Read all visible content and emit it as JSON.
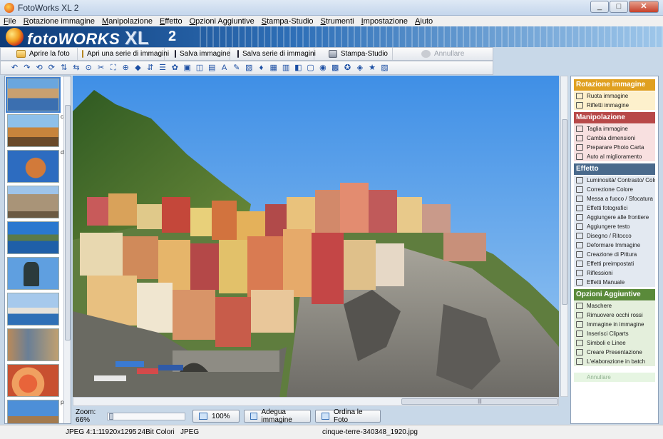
{
  "window": {
    "title": "FotoWorks XL 2",
    "minimize": "_",
    "maximize": "□",
    "close": "✕"
  },
  "menu": [
    "File",
    "Rotazione immagine",
    "Manipolazione",
    "Effetto",
    "Opzioni Aggiuntive",
    "Stampa-Studio",
    "Strumenti",
    "Impostazione",
    "Aiuto"
  ],
  "logo": {
    "main": "foto",
    "bold": "WORKS",
    "xl": "XL",
    "num": "2"
  },
  "toolbar": {
    "open": "Aprire la foto",
    "open_series": "Apri una serie di immagini",
    "save": "Salva immagine",
    "save_series": "Salva serie di immagini",
    "print": "Stampa-Studio",
    "undo": "Annullare"
  },
  "tools": [
    "↶",
    "↷",
    "⟲",
    "⟳",
    "⇅",
    "⇆",
    "⊙",
    "✂",
    "⛶",
    "⊕",
    "◆",
    "⇵",
    "☰",
    "✿",
    "▣",
    "◫",
    "▤",
    "A",
    "✎",
    "▧",
    "♦",
    "▦",
    "▥",
    "◧",
    "▢",
    "◉",
    "▩",
    "✪",
    "◈",
    "★",
    "▨"
  ],
  "thumb_labels": [
    "ci",
    "",
    "d",
    "",
    "",
    "",
    "",
    "",
    "",
    "",
    "p"
  ],
  "zoom": {
    "label": "Zoom: 66%",
    "btn_100": "100%",
    "btn_fit": "Adegua immagine",
    "btn_sort": "Ordina le Foto"
  },
  "status": {
    "format": "JPEG 4:1:1",
    "size": "1920x1295",
    "colors": "24Bit Colori",
    "type": "JPEG",
    "filename": "cinque-terre-340348_1920.jpg"
  },
  "panel": {
    "rotation": {
      "title": "Rotazione immagine",
      "color": "#e0a020",
      "item_bg": "#fdf0cc",
      "items": [
        "Ruota immagine",
        "Rifletti immagine"
      ]
    },
    "manip": {
      "title": "Manipolazione",
      "color": "#b84848",
      "item_bg": "#f8e0e0",
      "items": [
        "Taglia immagine",
        "Cambia dimensioni",
        "Preparare Photo Carta",
        "Auto al miglioramento"
      ]
    },
    "effect": {
      "title": "Effetto",
      "color": "#4a6a8c",
      "item_bg": "#e3e9f1",
      "items": [
        "Luminosità/ Contrasto/ Colore",
        "Correzione Colore",
        "Messa a fuoco / Sfocatura",
        "Effetti fotografici",
        "Aggiungere alle frontiere",
        "Aggiungere testo",
        "Disegno / Ritocco",
        "Deformare Immagine",
        "Creazione di Pittura",
        "Effetti preimpostati",
        "Riflessioni",
        "Effetti Manuale"
      ]
    },
    "options": {
      "title": "Opzioni Aggiuntive",
      "color": "#5a8a3a",
      "item_bg": "#e4efdc",
      "items": [
        "Maschere",
        "Rimuovere occhi rossi",
        "Immagine in immagine",
        "Inserisci Cliparts",
        "Simboli e Linee",
        "Creare Presentazione",
        "L'elaborazione in batch"
      ]
    },
    "undo": "Annullare"
  },
  "colors": {
    "sky": "#5da3e4",
    "sea": "#1a6aa8",
    "hill": "#3e6b2a",
    "rock": "#8c8a84"
  }
}
